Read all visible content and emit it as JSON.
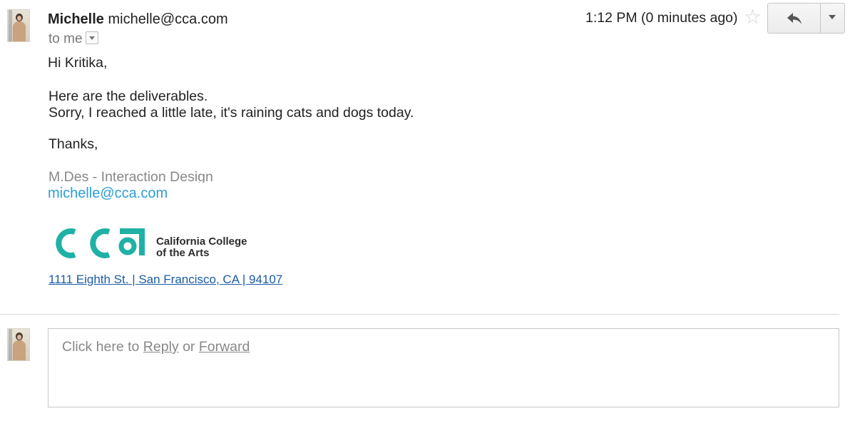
{
  "header": {
    "sender_name": "Michelle",
    "sender_email": "michelle@cca.com",
    "to_label": "to me",
    "timestamp": "1:12 PM (0 minutes ago)"
  },
  "icons": {
    "star": "star-icon",
    "reply": "reply-arrow-icon",
    "more": "chevron-down-icon"
  },
  "message": {
    "greeting": "Hi Kritika,",
    "line1": "Here are the deliverables.",
    "line2": "Sorry, I reached a little late, it's raining cats and dogs today.",
    "closing": "Thanks,"
  },
  "signature": {
    "title": "M.Des - Interaction Design",
    "email": "michelle@cca.com",
    "logo_mark": "cca",
    "logo_line1": "California College",
    "logo_line2": "of the Arts",
    "address": "1111 Eighth St. | San Francisco, CA | 94107"
  },
  "reply_box": {
    "prefix": "Click here to ",
    "reply_link": "Reply",
    "middle": " or ",
    "forward_link": "Forward"
  },
  "colors": {
    "logo_teal": "#1fb1a5",
    "link_blue": "#2a9fd8",
    "address_blue": "#1a5ca8"
  }
}
